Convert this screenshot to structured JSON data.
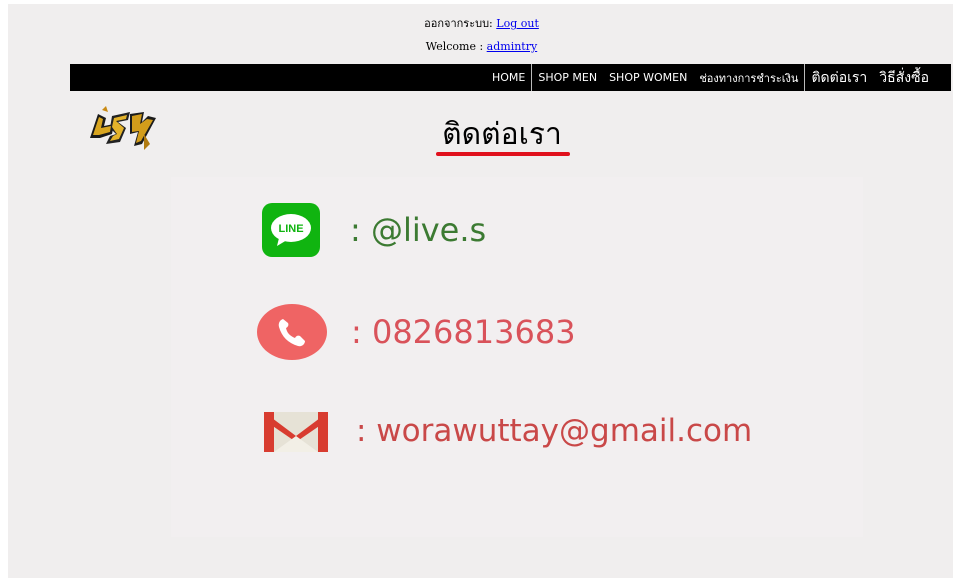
{
  "header": {
    "logout_prefix": "ออกจากระบบ: ",
    "logout_label": "Log out",
    "welcome_prefix": "Welcome : ",
    "username": "admintry"
  },
  "nav": {
    "items": [
      "HOME",
      "SHOP MEN",
      "SHOP WOMEN",
      "ช่องทางการชำระเงิน",
      "ติดต่อเรา",
      "วิธีสั่งซื้อ"
    ]
  },
  "logo": {
    "text": "LSV"
  },
  "page": {
    "title": "ติดต่อเรา"
  },
  "contacts": {
    "line": {
      "icon": "line-icon",
      "icon_text": "LINE",
      "text": ": @live.s"
    },
    "phone": {
      "icon": "phone-icon",
      "text": ": 0826813683"
    },
    "email": {
      "icon": "mail-icon",
      "text": ": worawuttay@gmail.com"
    }
  },
  "colors": {
    "navbar": "#000000",
    "title_underline": "#e0101c",
    "line_green": "#10b410",
    "phone_red": "#ef6464",
    "line_text": "#3c7a32",
    "phone_text": "#d9525a",
    "mail_text": "#c94848"
  }
}
